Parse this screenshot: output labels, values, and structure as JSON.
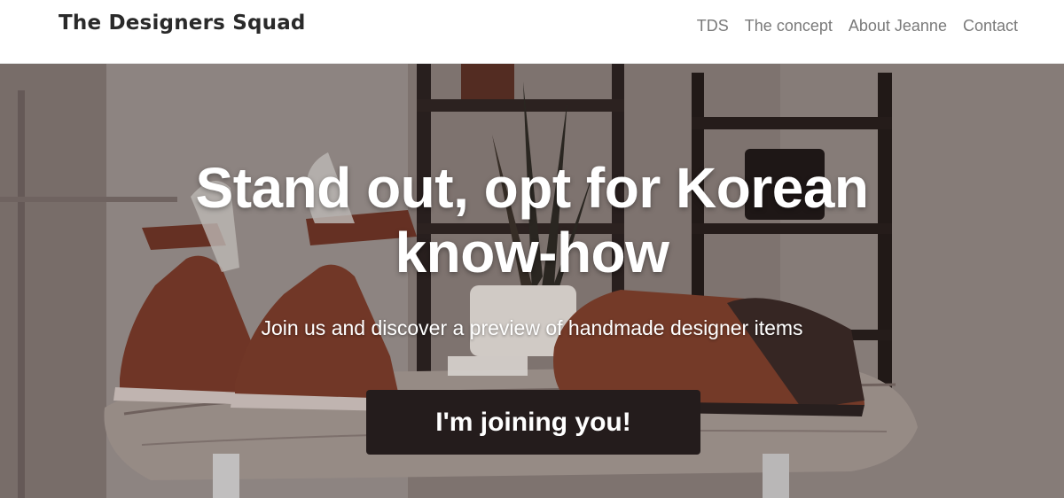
{
  "header": {
    "brand": "The Designers Squad",
    "nav": [
      {
        "label": "TDS"
      },
      {
        "label": "The concept"
      },
      {
        "label": "About Jeanne"
      },
      {
        "label": "Contact"
      }
    ]
  },
  "hero": {
    "title_line1": "Stand out, opt for Korean",
    "title_line2": "know-how",
    "subtitle": "Join us and discover a preview of handmade designer items",
    "cta_label": "I'm joining you!"
  },
  "colors": {
    "cta_background": "#241c1c",
    "nav_text": "#7a7a7a",
    "brand_text": "#2a2a2a"
  }
}
